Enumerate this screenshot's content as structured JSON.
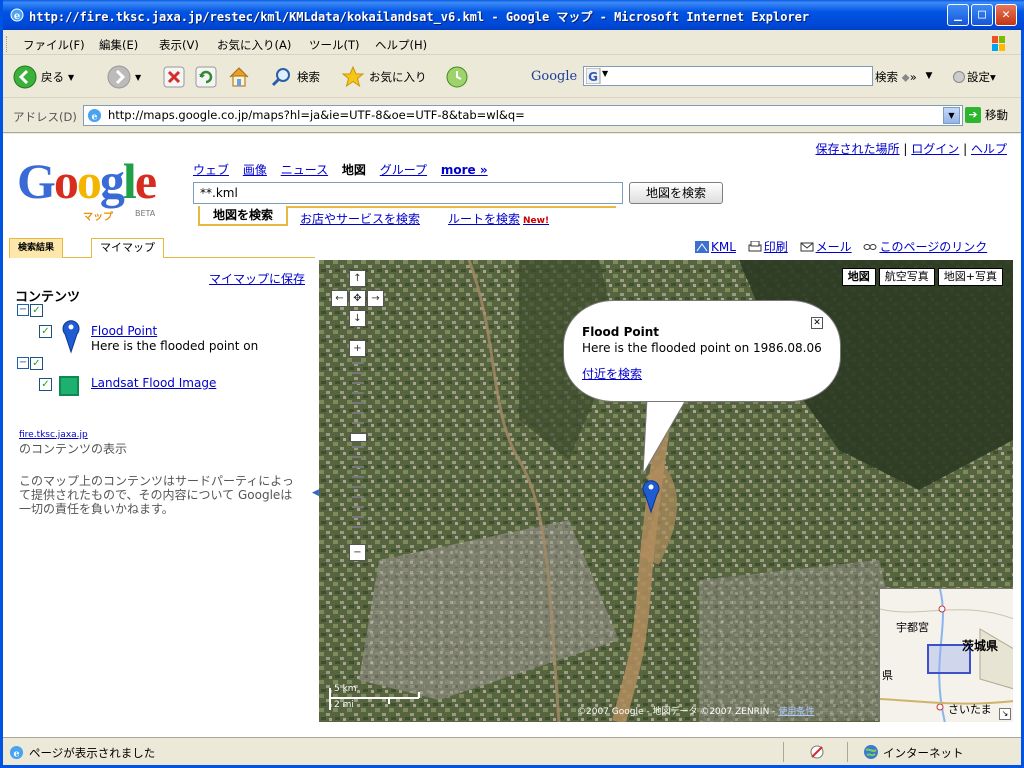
{
  "window": {
    "title": "http://fire.tksc.jaxa.jp/restec/kml/KMLdata/kokailandsat_v6.kml - Google マップ - Microsoft Internet Explorer",
    "minimize": "_",
    "maximize": "□",
    "close": "✕"
  },
  "menubar": {
    "items": [
      "ファイル(F)",
      "編集(E)",
      "表示(V)",
      "お気に入り(A)",
      "ツール(T)",
      "ヘルプ(H)"
    ]
  },
  "toolbar": {
    "back": "戻る",
    "search": "検索",
    "favorites": "お気に入り",
    "google_logo": "Google",
    "google_search": "検索",
    "google_settings": "設定"
  },
  "addressbar": {
    "label": "アドレス(D)",
    "url": "http://maps.google.co.jp/maps?hl=ja&ie=UTF-8&oe=UTF-8&tab=wl&q=",
    "go": "移動"
  },
  "google": {
    "logo": "Google",
    "logo_sub": "マップ",
    "beta": "BETA",
    "nav": {
      "web": "ウェブ",
      "images": "画像",
      "news": "ニュース",
      "maps": "地図",
      "groups": "グループ",
      "more": "more »"
    },
    "search_value": "**.kml",
    "search_button": "地図を検索",
    "subtabs": {
      "active": "地図を検索",
      "business": "お店やサービスを検索",
      "directions": "ルートを検索",
      "new": "New!"
    },
    "top_links": {
      "saved": "保存された場所",
      "sep1": "|",
      "login": "ログイン",
      "sep2": "|",
      "help": "ヘルプ"
    }
  },
  "panel": {
    "tabs": [
      "検索結果",
      "マイマップ"
    ],
    "tools": {
      "kml": "KML",
      "print": "印刷",
      "mail": "メール",
      "link": "このページのリンク"
    },
    "save_link": "マイマップに保存",
    "contents_heading": "コンテンツ",
    "items": [
      {
        "title": "Flood Point",
        "desc": "Here is the flooded point on"
      },
      {
        "title": "Landsat Flood Image"
      }
    ],
    "source_link": "fire.tksc.jaxa.jp",
    "source_desc": "のコンテンツの表示",
    "disclaimer": "このマップ上のコンテンツはサードパーティによって提供されたもので、その内容について Googleは一切の責任を負いかねます。"
  },
  "map": {
    "types": [
      "地図",
      "航空写真",
      "地図+写真"
    ],
    "active_type": "地図",
    "bubble": {
      "title": "Flood Point",
      "text": "Here is the flooded point on 1986.08.06",
      "link": "付近を検索"
    },
    "scale_km": "5 km",
    "scale_mi": "2 mi",
    "copyright": "©2007 Google - 地図データ ©2007 ZENRIN -",
    "copyright_link": "使用条件",
    "overview_labels": [
      "宇都宮",
      "茨城県",
      "県",
      "さいたま"
    ]
  },
  "statusbar": {
    "text": "ページが表示されました",
    "zone": "インターネット"
  },
  "colors": {
    "titlebar": "#0054e3",
    "chrome": "#ece9d8",
    "link": "#0000cc",
    "accent": "#e8b940"
  }
}
